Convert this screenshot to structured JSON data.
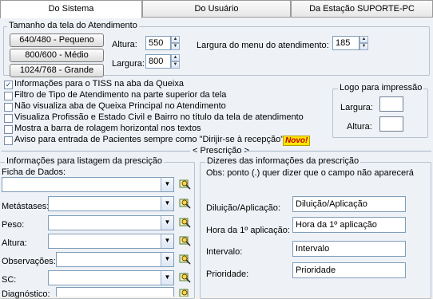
{
  "tabs": [
    {
      "label": "Do Sistema",
      "active": true
    },
    {
      "label": "Do Usuário",
      "active": false
    },
    {
      "label": "Da Estação SUPORTE-PC",
      "active": false
    }
  ],
  "screen_size": {
    "title": "Tamanho da tela do Atendimento",
    "buttons": [
      "640/480 - Pequeno",
      "800/600 - Médio",
      "1024/768 - Grande"
    ],
    "height_label": "Altura:",
    "height_value": "550",
    "width_label": "Largura:",
    "width_value": "800",
    "menu_width_label": "Largura do menu do atendimento:",
    "menu_width_value": "185"
  },
  "options": [
    {
      "label": "Informações para o TISS na aba da Queixa",
      "checked": true
    },
    {
      "label": "Filtro de Tipo de Atendimento na parte superior da tela",
      "checked": false
    },
    {
      "label": "Não visualiza aba de Queixa Principal no Atendimento",
      "checked": false
    },
    {
      "label": "Visualiza Profissão e Estado Civil e Bairro no título da tela de atendimento",
      "checked": false
    },
    {
      "label": "Mostra a barra de rolagem horizontal nos textos",
      "checked": false
    },
    {
      "label": "Aviso para entrada de Pacientes sempre como \"Dirijir-se à recepção\"",
      "checked": false
    }
  ],
  "novo_badge": "Novo!",
  "logo": {
    "title": "Logo para impressão",
    "width_label": "Largura:",
    "height_label": "Altura:"
  },
  "prescricao_divider": "< Prescrição >",
  "listagem": {
    "title": "Informações para listagem da prescição",
    "fields": [
      "Ficha de Dados:",
      "Metástases:",
      "Peso:",
      "Altura:",
      "Observações:",
      "SC:",
      "Diagnóstico:"
    ]
  },
  "dizeres": {
    "title": "Dizeres das informações da prescrição",
    "note": "Obs: ponto (.) quer dizer que o campo não aparecerá",
    "fields": [
      {
        "label": "Diluição/Aplicação:",
        "value": "Diluição/Aplicação"
      },
      {
        "label": "Hora da 1º aplicação:",
        "value": "Hora da 1º aplicação"
      },
      {
        "label": "Intervalo:",
        "value": "Intervalo"
      },
      {
        "label": "Prioridade:",
        "value": "Prioridade"
      }
    ]
  },
  "colors": {
    "panel": "#eef2f7",
    "novo_bg": "#ffe600",
    "novo_text": "#c00000"
  }
}
